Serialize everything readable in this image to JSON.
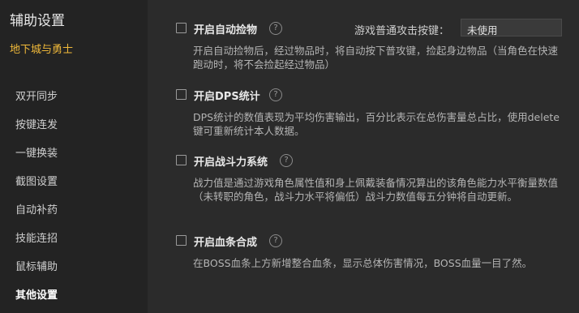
{
  "app": {
    "title": "辅助设置",
    "game_name": "地下城与勇士"
  },
  "sidebar": {
    "items": [
      {
        "label": "双开同步",
        "active": false
      },
      {
        "label": "按键连发",
        "active": false
      },
      {
        "label": "一键换装",
        "active": false
      },
      {
        "label": "截图设置",
        "active": false
      },
      {
        "label": "自动补药",
        "active": false
      },
      {
        "label": "技能连招",
        "active": false
      },
      {
        "label": "鼠标辅助",
        "active": false
      },
      {
        "label": "其他设置",
        "active": true
      }
    ]
  },
  "options": [
    {
      "title": "开启自动捡物",
      "checked": false,
      "desc": "开启自动捡物后，经过物品时，将自动按下普攻键，捡起身边物品（当角色在快速跑动时，将不会捡起经过物品）",
      "key_label": "游戏普通攻击按键：",
      "key_value": "未使用"
    },
    {
      "title": "开启DPS统计",
      "checked": false,
      "desc": "DPS统计的数值表现为平均伤害输出，百分比表示在总伤害量总占比，使用delete键可重新统计本人数据。"
    },
    {
      "title": "开启战斗力系统",
      "checked": false,
      "desc": "战力值是通过游戏角色属性值和身上佩戴装备情况算出的该角色能力水平衡量数值（未转职的角色，战斗力水平将偏低）战斗力数值每五分钟将自动更新。"
    },
    {
      "title": "开启血条合成",
      "checked": false,
      "desc": "在BOSS血条上方新增整合血条，显示总体伤害情况，BOSS血量一目了然。"
    }
  ],
  "help_glyph": "?",
  "colors": {
    "accent": "#f0b93a",
    "sidebar_bg": "#232323",
    "main_bg": "#2b2b2b"
  }
}
